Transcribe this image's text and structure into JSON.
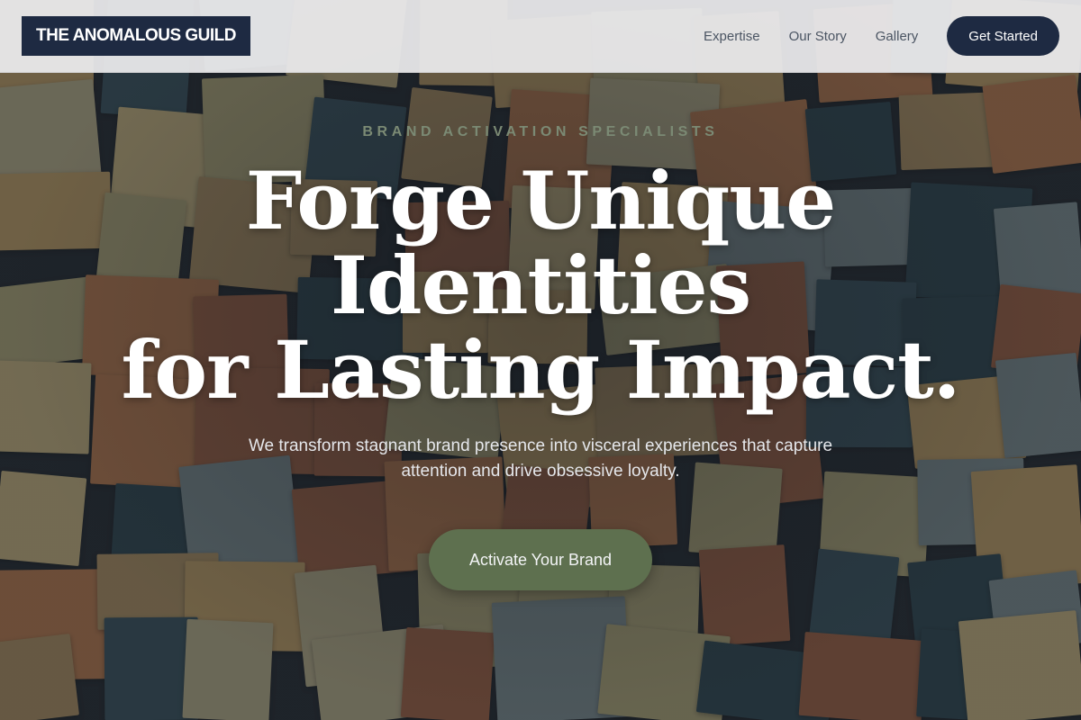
{
  "header": {
    "logo": "THE ANOMALOUS GUILD",
    "nav": [
      {
        "label": "Expertise"
      },
      {
        "label": "Our Story"
      },
      {
        "label": "Gallery"
      }
    ],
    "cta_label": "Get Started"
  },
  "hero": {
    "eyebrow": "BRAND ACTIVATION SPECIALISTS",
    "title_lines": [
      "Forge Unique",
      "Identities",
      "for Lasting Impact."
    ],
    "subtitle": "We transform stagnant brand presence into visceral experiences that capture attention and drive obsessive loyalty.",
    "cta_label": "Activate Your Brand"
  },
  "colors": {
    "brand_navy": "#1e2a42",
    "accent_green": "#5e704f",
    "eyebrow_green": "#7b8a74",
    "header_bg": "#ececee"
  }
}
